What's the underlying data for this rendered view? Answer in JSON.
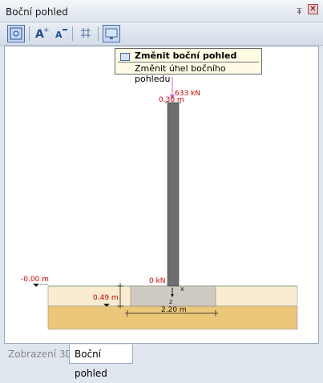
{
  "panel": {
    "title": "Boční pohled"
  },
  "window_controls": {
    "pin": "⍕",
    "close": "✕"
  },
  "tooltip": {
    "title": "Změnit boční pohled",
    "description": "Změnit úhel bočního pohledu"
  },
  "drawing": {
    "load_label": "633 kN",
    "column_width_label": "0.30 m",
    "top_level_label": "-0.00 m",
    "zero_load_label": "0 kN",
    "depth_label": "0.49 m",
    "footing_width_label": "2.20 m",
    "axis_x": "x",
    "axis_z": "z",
    "colors": {
      "load": "#e05ad6",
      "column": "#6e6e6e",
      "footing": "#cfcbc2",
      "soil_top": "#f9ecd0",
      "soil_bottom": "#ecc77a",
      "dim_red": "#d40000"
    }
  },
  "tabs": [
    {
      "label": "Zobrazení 3D",
      "active": false
    },
    {
      "label": "Boční pohled",
      "active": true
    }
  ]
}
